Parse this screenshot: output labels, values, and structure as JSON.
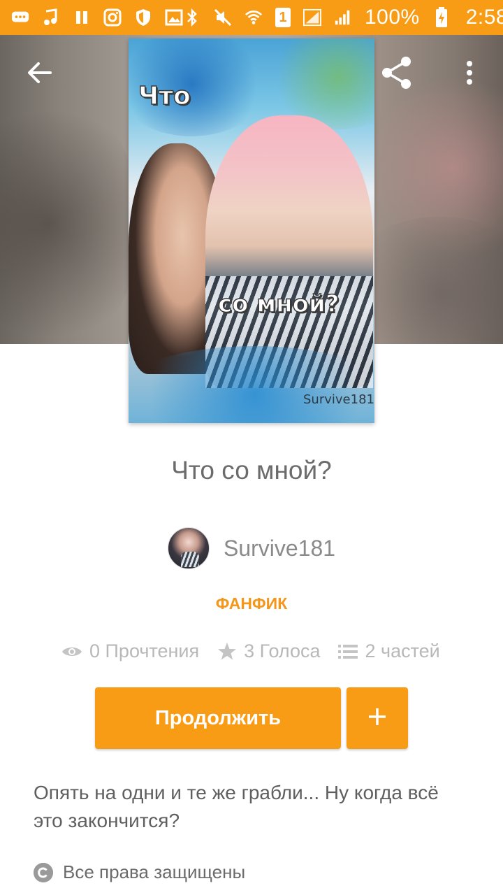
{
  "status_bar": {
    "battery": "100%",
    "time": "2:58",
    "sim_slot": "1",
    "icons": [
      "chat-icon",
      "music-icon",
      "pause-icon",
      "instagram-icon",
      "shield-icon",
      "image-icon",
      "bluetooth-icon",
      "mute-icon",
      "wifi-icon",
      "sim-icon",
      "signal-icon",
      "signal-icon",
      "battery-charging-icon"
    ]
  },
  "header": {
    "back_icon": "arrow-left-icon",
    "share_icon": "share-icon",
    "more_icon": "more-vertical-icon"
  },
  "cover": {
    "text_top": "Что",
    "text_bottom": "со мной?",
    "signature": "Survive181"
  },
  "story": {
    "title": "Что со мной?",
    "author": "Survive181",
    "category": "ФАНФИК",
    "stats": {
      "reads": "0 Прочтения",
      "votes": "3 Голоса",
      "parts": "2 частей"
    },
    "continue_label": "Продолжить",
    "add_label": "+",
    "description": "Опять на одни и те же грабли... Ну когда всё это закончится?",
    "copyright": "Все права защищены"
  },
  "colors": {
    "accent": "#f89c15",
    "category": "#f5961a"
  }
}
